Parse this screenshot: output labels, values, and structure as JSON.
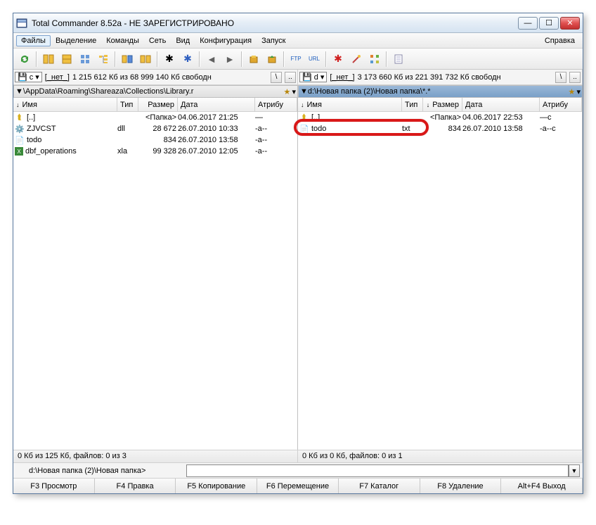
{
  "title": "Total Commander 8.52a - НЕ ЗАРЕГИСТРИРОВАНО",
  "menu": {
    "files": "Файлы",
    "select": "Выделение",
    "commands": "Команды",
    "net": "Сеть",
    "view": "Вид",
    "config": "Конфигурация",
    "start": "Запуск",
    "help": "Справка"
  },
  "drives": {
    "left": {
      "letter": "c",
      "none": "[_нет_]",
      "info": "1 215 612 Кб из 68 999 140 Кб свободн"
    },
    "right": {
      "letter": "d",
      "none": "[_нет_]",
      "info": "3 173 660 Кб из 221 391 732 Кб свободн"
    }
  },
  "paths": {
    "left": "\\AppData\\Roaming\\Shareaza\\Collections\\Library.r",
    "right": "d:\\Новая папка (2)\\Новая папка\\*.*"
  },
  "headers": {
    "name": "Имя",
    "type": "Тип",
    "size": "Размер",
    "date": "Дата",
    "attr": "Атрибу"
  },
  "left_files": [
    {
      "name": "[..]",
      "type": "",
      "size": "<Папка>",
      "date": "04.06.2017 21:25",
      "attr": "—",
      "icon": "up"
    },
    {
      "name": "ZJVCST",
      "type": "dll",
      "size": "28 672",
      "date": "26.07.2010 10:33",
      "attr": "-a--",
      "icon": "gear"
    },
    {
      "name": "todo",
      "type": "",
      "size": "834",
      "date": "26.07.2010 13:58",
      "attr": "-a--",
      "icon": "file"
    },
    {
      "name": "dbf_operations",
      "type": "xla",
      "size": "99 328",
      "date": "26.07.2010 12:05",
      "attr": "-a--",
      "icon": "xls"
    }
  ],
  "right_files": [
    {
      "name": "[..]",
      "type": "",
      "size": "<Папка>",
      "date": "04.06.2017 22:53",
      "attr": "—c",
      "icon": "up"
    },
    {
      "name": "todo",
      "type": "txt",
      "size": "834",
      "date": "26.07.2010 13:58",
      "attr": "-a--c",
      "icon": "file"
    }
  ],
  "status": {
    "left": "0 Кб из 125 Кб, файлов: 0 из 3",
    "right": "0 Кб из 0 Кб, файлов: 0 из 1"
  },
  "cmd_prompt": "d:\\Новая папка (2)\\Новая папка>",
  "fkeys": [
    "F3 Просмотр",
    "F4 Правка",
    "F5 Копирование",
    "F6 Перемещение",
    "F7 Каталог",
    "F8 Удаление",
    "Alt+F4 Выход"
  ]
}
